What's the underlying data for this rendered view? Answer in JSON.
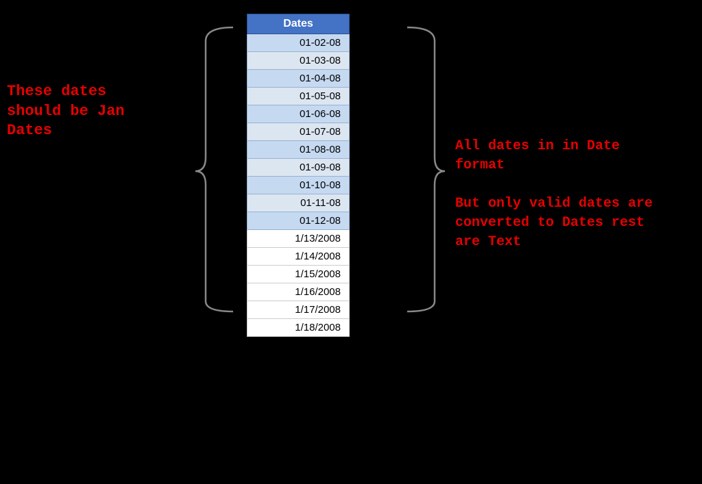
{
  "table": {
    "header": "Dates",
    "blue_rows": [
      "01-02-08",
      "01-03-08",
      "01-04-08",
      "01-05-08",
      "01-06-08",
      "01-07-08",
      "01-08-08",
      "01-09-08",
      "01-10-08",
      "01-11-08",
      "01-12-08"
    ],
    "white_rows": [
      "1/13/2008",
      "1/14/2008",
      "1/15/2008",
      "1/16/2008",
      "1/17/2008",
      "1/18/2008"
    ]
  },
  "left_annotation": {
    "text": "These dates should be Jan Dates"
  },
  "right_annotation": {
    "line1": "All dates in in Date format",
    "line2": "But only valid dates are converted to Dates rest are Text"
  }
}
